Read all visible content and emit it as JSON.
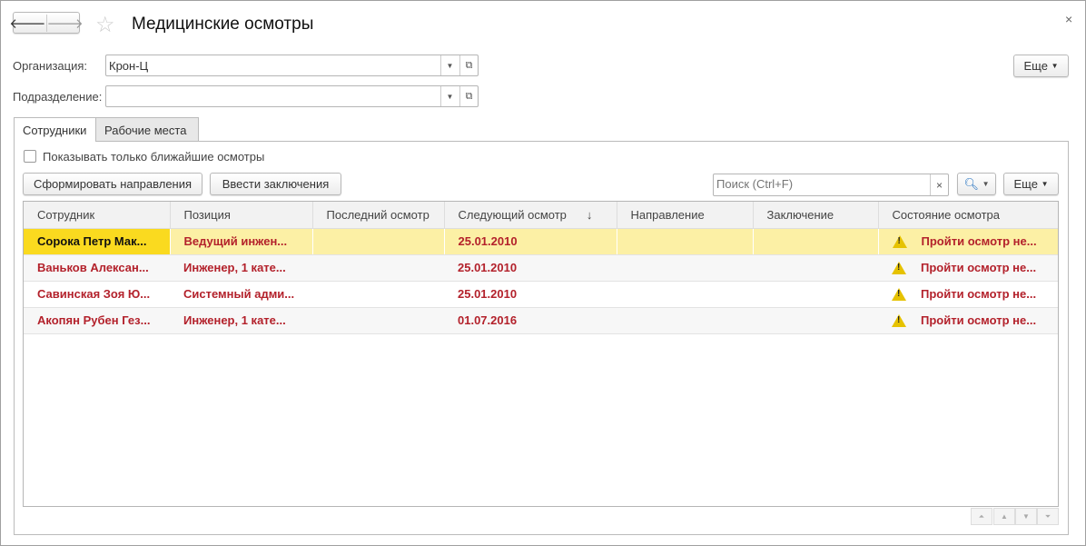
{
  "title": "Медицинские осмотры",
  "more_label": "Еще",
  "org": {
    "label": "Организация:",
    "value": "Крон-Ц"
  },
  "dept": {
    "label": "Подразделение:",
    "value": ""
  },
  "tabs": [
    {
      "label": "Сотрудники"
    },
    {
      "label": "Рабочие места"
    }
  ],
  "checkbox_label": "Показывать только ближайшие осмотры",
  "toolbar": {
    "form_directions": "Сформировать направления",
    "enter_conclusions": "Ввести заключения",
    "search_placeholder": "Поиск (Ctrl+F)",
    "more": "Еще"
  },
  "columns": [
    "Сотрудник",
    "Позиция",
    "Последний осмотр",
    "Следующий осмотр",
    "Направление",
    "Заключение",
    "Состояние осмотра"
  ],
  "sort_indicator": "↓",
  "rows": [
    {
      "employee": "Сорока Петр Мак...",
      "position": "Ведущий инжен...",
      "last": "",
      "next": "25.01.2010",
      "direction": "",
      "conclusion": "",
      "status": "Пройти осмотр не..."
    },
    {
      "employee": "Ваньков Алексан...",
      "position": "Инженер, 1 кате...",
      "last": "",
      "next": "25.01.2010",
      "direction": "",
      "conclusion": "",
      "status": "Пройти осмотр не..."
    },
    {
      "employee": "Савинская Зоя Ю...",
      "position": "Системный адми...",
      "last": "",
      "next": "25.01.2010",
      "direction": "",
      "conclusion": "",
      "status": "Пройти осмотр не..."
    },
    {
      "employee": "Акопян Рубен Гез...",
      "position": "Инженер, 1 кате...",
      "last": "",
      "next": "01.07.2016",
      "direction": "",
      "conclusion": "",
      "status": "Пройти осмотр не..."
    }
  ]
}
